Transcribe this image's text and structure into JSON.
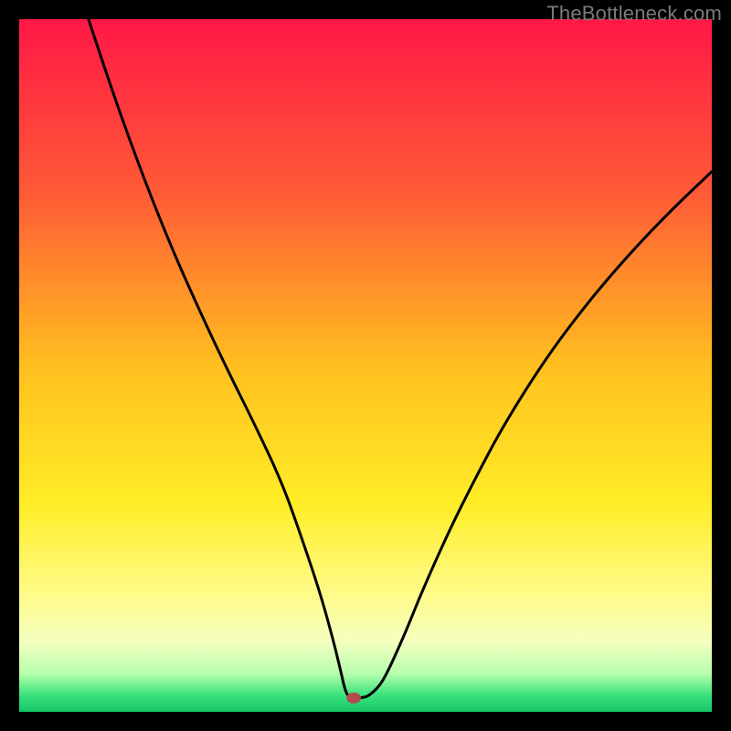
{
  "watermark": "TheBottleneck.com",
  "chart_data": {
    "type": "line",
    "title": "",
    "xlabel": "",
    "ylabel": "",
    "xlim": [
      0,
      100
    ],
    "ylim": [
      0,
      100
    ],
    "grid": false,
    "legend": null,
    "background_gradient_stops": [
      {
        "pos": 0.0,
        "color": "#ff1846"
      },
      {
        "pos": 0.25,
        "color": "#ff5a36"
      },
      {
        "pos": 0.5,
        "color": "#ffbf1f"
      },
      {
        "pos": 0.7,
        "color": "#ffed27"
      },
      {
        "pos": 0.83,
        "color": "#fffb89"
      },
      {
        "pos": 0.9,
        "color": "#f4ffc0"
      },
      {
        "pos": 0.945,
        "color": "#b6ffac"
      },
      {
        "pos": 0.975,
        "color": "#3de37e"
      },
      {
        "pos": 1.0,
        "color": "#14c768"
      }
    ],
    "series": [
      {
        "name": "bottleneck-curve",
        "stroke": "#000000",
        "x": [
          10,
          14,
          18,
          22,
          26,
          30,
          34,
          38,
          41,
          43.5,
          45.3,
          46.4,
          47,
          47.5,
          48.2,
          49.5,
          50.5,
          52,
          53,
          54,
          56,
          58,
          62,
          66,
          70,
          76,
          82,
          88,
          94,
          100
        ],
        "y": [
          100,
          88,
          77,
          67,
          58,
          49.5,
          41.5,
          33,
          24.5,
          17,
          10.5,
          6,
          3.3,
          2.2,
          2.0,
          2.0,
          2.3,
          3.7,
          5.4,
          7.5,
          12,
          17,
          26,
          34,
          41.5,
          51,
          59,
          66,
          72.3,
          78
        ]
      }
    ],
    "marker": {
      "name": "optimal-point",
      "x": 48.3,
      "y": 2.0,
      "fill": "#b24c4c",
      "rx": 8,
      "ry": 6
    }
  }
}
